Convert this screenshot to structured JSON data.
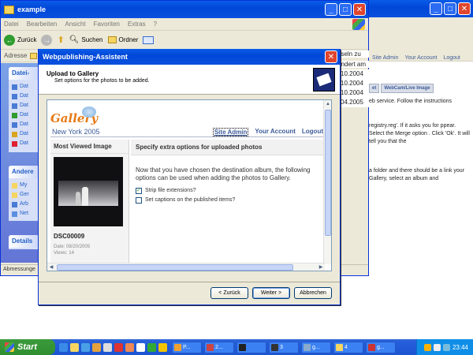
{
  "explorer": {
    "title": "example",
    "menu": [
      "Datei",
      "Bearbeiten",
      "Ansicht",
      "Favoriten",
      "Extras",
      "?"
    ],
    "toolbar": {
      "back": "Zurück",
      "search": "Suchen",
      "folders": "Ordner"
    },
    "address_label": "Adresse",
    "side_heads": [
      "Datei-",
      "Andere",
      "Details"
    ],
    "side_file_items": [
      "Dat",
      "Dat",
      "Dat",
      "Dat",
      "Dat",
      "Dat",
      "Dat"
    ],
    "side_other_items": [
      "My",
      "Ger",
      "Arb",
      "Net"
    ],
    "status": "Abmessunge"
  },
  "browser2": {
    "peek_text": "hseln zu",
    "changed": "ändert am",
    "dates": [
      "10.2004",
      "10.2004",
      "10.2004",
      "04.2005"
    ],
    "links": [
      "Site Admin",
      "Your Account",
      "Logout"
    ],
    "tabs": [
      "et",
      "WebCam/Live Image"
    ],
    "text1": "eb service. Follow the instructions",
    "text2": "registry.reg'. If it asks you for ppear. Select the Merge option . Click 'Ok'. It will tell you that the",
    "text3": "a folder and there should be a link your Gallery, select an album and"
  },
  "dialog": {
    "title": "Webpublishing-Assistent",
    "header_title": "Upload to Gallery",
    "header_sub": "Set options for the photos to be added.",
    "buttons": {
      "back": "< Zurück",
      "next": "Weiter >",
      "cancel": "Abbrechen"
    }
  },
  "gallery": {
    "logo": "Gallery",
    "album": "New York 2005",
    "links": {
      "admin": "Site Admin",
      "account": "Your Account",
      "logout": "Logout"
    },
    "left_heading": "Most Viewed Image",
    "photo_name": "DSC00009",
    "photo_date": "Date: 08/20/2005",
    "photo_views": "Views: 14",
    "right_heading": "Specify extra options for uploaded photos",
    "intro": "Now that you have chosen the destination album, the following options can be used when adding the photos to Gallery.",
    "options": [
      {
        "label": "Strip file extensions?",
        "checked": true
      },
      {
        "label": "Set captions on the published items?",
        "checked": false
      }
    ]
  },
  "taskbar": {
    "start": "Start",
    "tasks": [
      "P...",
      "2...",
      "",
      "3",
      "g...",
      "4",
      "g..."
    ],
    "clock": "23:44"
  }
}
